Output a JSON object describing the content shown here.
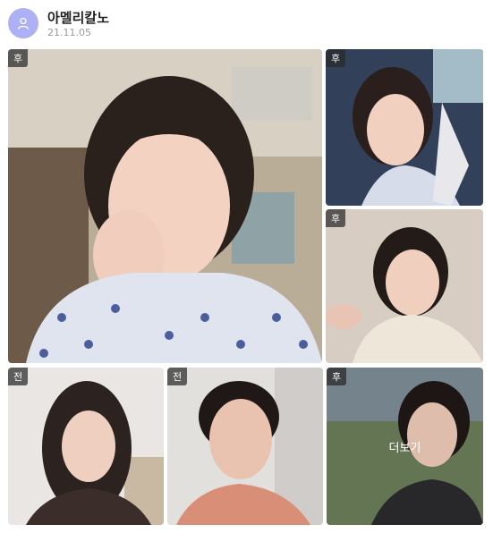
{
  "author": {
    "name": "아멜리칼노",
    "date": "21.11.05",
    "avatar_icon": "user-icon"
  },
  "photos": [
    {
      "tag": "후",
      "alt": "photo-1"
    },
    {
      "tag": "후",
      "alt": "photo-2"
    },
    {
      "tag": "후",
      "alt": "photo-3"
    },
    {
      "tag": "전",
      "alt": "photo-4"
    },
    {
      "tag": "전",
      "alt": "photo-5"
    },
    {
      "tag": "후",
      "alt": "photo-6"
    }
  ],
  "more_label": "더보기",
  "colors": {
    "avatar_bg": "#aeb0f5",
    "tag_bg": "#333333"
  }
}
